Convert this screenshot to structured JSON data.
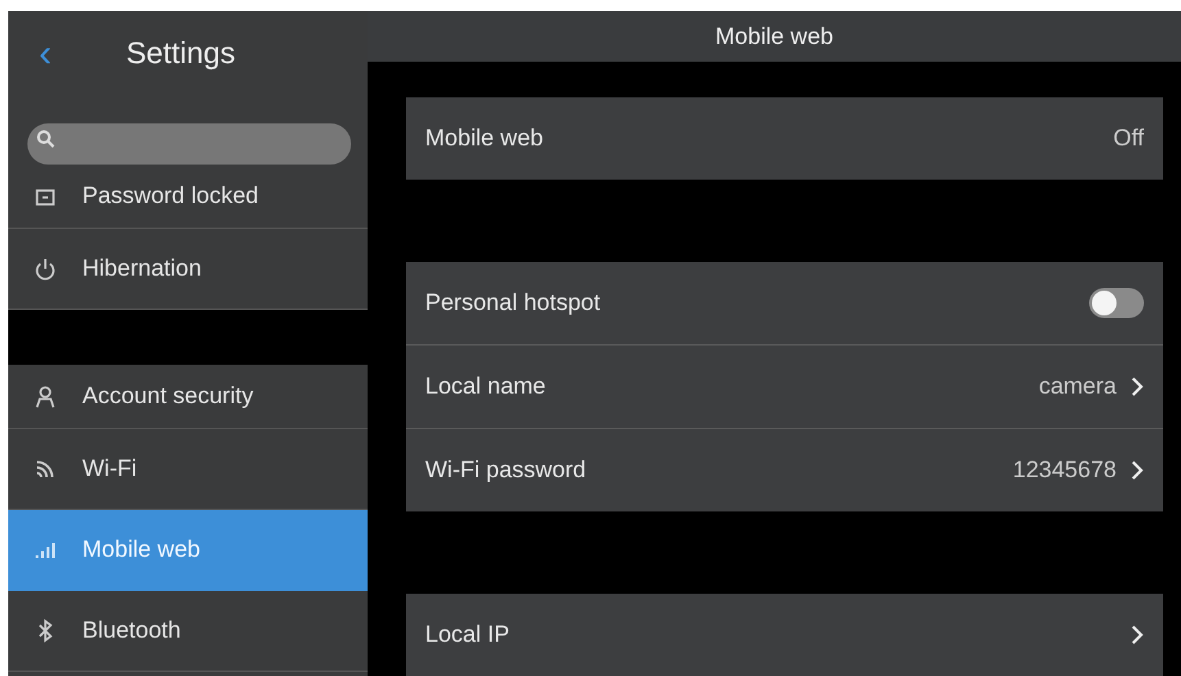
{
  "sidebar": {
    "title": "Settings",
    "back": "‹",
    "groups": [
      [
        {
          "label": "Password locked",
          "selected": false
        },
        {
          "label": "Hibernation",
          "selected": false
        }
      ],
      [
        {
          "label": "Account security",
          "selected": false
        },
        {
          "label": "Wi-Fi",
          "selected": false
        },
        {
          "label": "Mobile web",
          "selected": true
        },
        {
          "label": "Bluetooth",
          "selected": false
        }
      ]
    ]
  },
  "main": {
    "title": "Mobile web",
    "groups": [
      [
        {
          "kind": "value",
          "label": "Mobile web",
          "value": "Off"
        }
      ],
      [
        {
          "kind": "toggle",
          "label": "Personal hotspot",
          "on": false
        },
        {
          "kind": "link",
          "label": "Local name",
          "value": "camera"
        },
        {
          "kind": "link",
          "label": "Wi-Fi password",
          "value": "12345678"
        }
      ],
      [
        {
          "kind": "link",
          "label": "Local IP"
        }
      ]
    ]
  }
}
